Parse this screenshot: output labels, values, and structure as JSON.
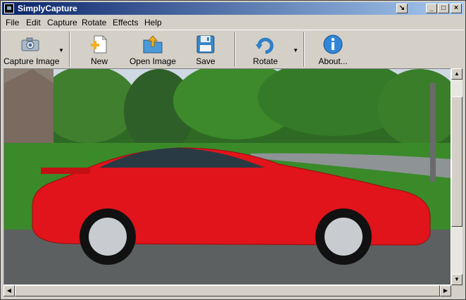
{
  "window": {
    "title": "SimplyCapture"
  },
  "menu": [
    "File",
    "Edit",
    "Capture",
    "Rotate",
    "Effects",
    "Help"
  ],
  "toolbar": {
    "capture_image": "Capture Image",
    "new": "New",
    "open_image": "Open Image",
    "save": "Save",
    "rotate": "Rotate",
    "about": "About..."
  },
  "colors": {
    "titlebar": "#0a246a",
    "car": "#e0141a",
    "grass": "#3a8a2a"
  }
}
